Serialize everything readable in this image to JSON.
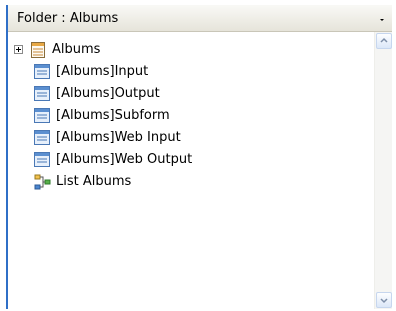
{
  "folder": {
    "title": "Folder : Albums",
    "menu_icon": "dropdown-arrow"
  },
  "tree": {
    "root": {
      "label": "Albums",
      "icon": "table-icon",
      "expanded": false
    },
    "items": [
      {
        "label": "[Albums]Input",
        "icon": "form-icon"
      },
      {
        "label": "[Albums]Output",
        "icon": "form-icon"
      },
      {
        "label": "[Albums]Subform",
        "icon": "form-icon"
      },
      {
        "label": "[Albums]Web Input",
        "icon": "form-icon"
      },
      {
        "label": "[Albums]Web Output",
        "icon": "form-icon"
      },
      {
        "label": "List Albums",
        "icon": "method-icon"
      }
    ]
  },
  "colors": {
    "accent": "#2f6fc7",
    "header_bg": "#ece9d8"
  }
}
